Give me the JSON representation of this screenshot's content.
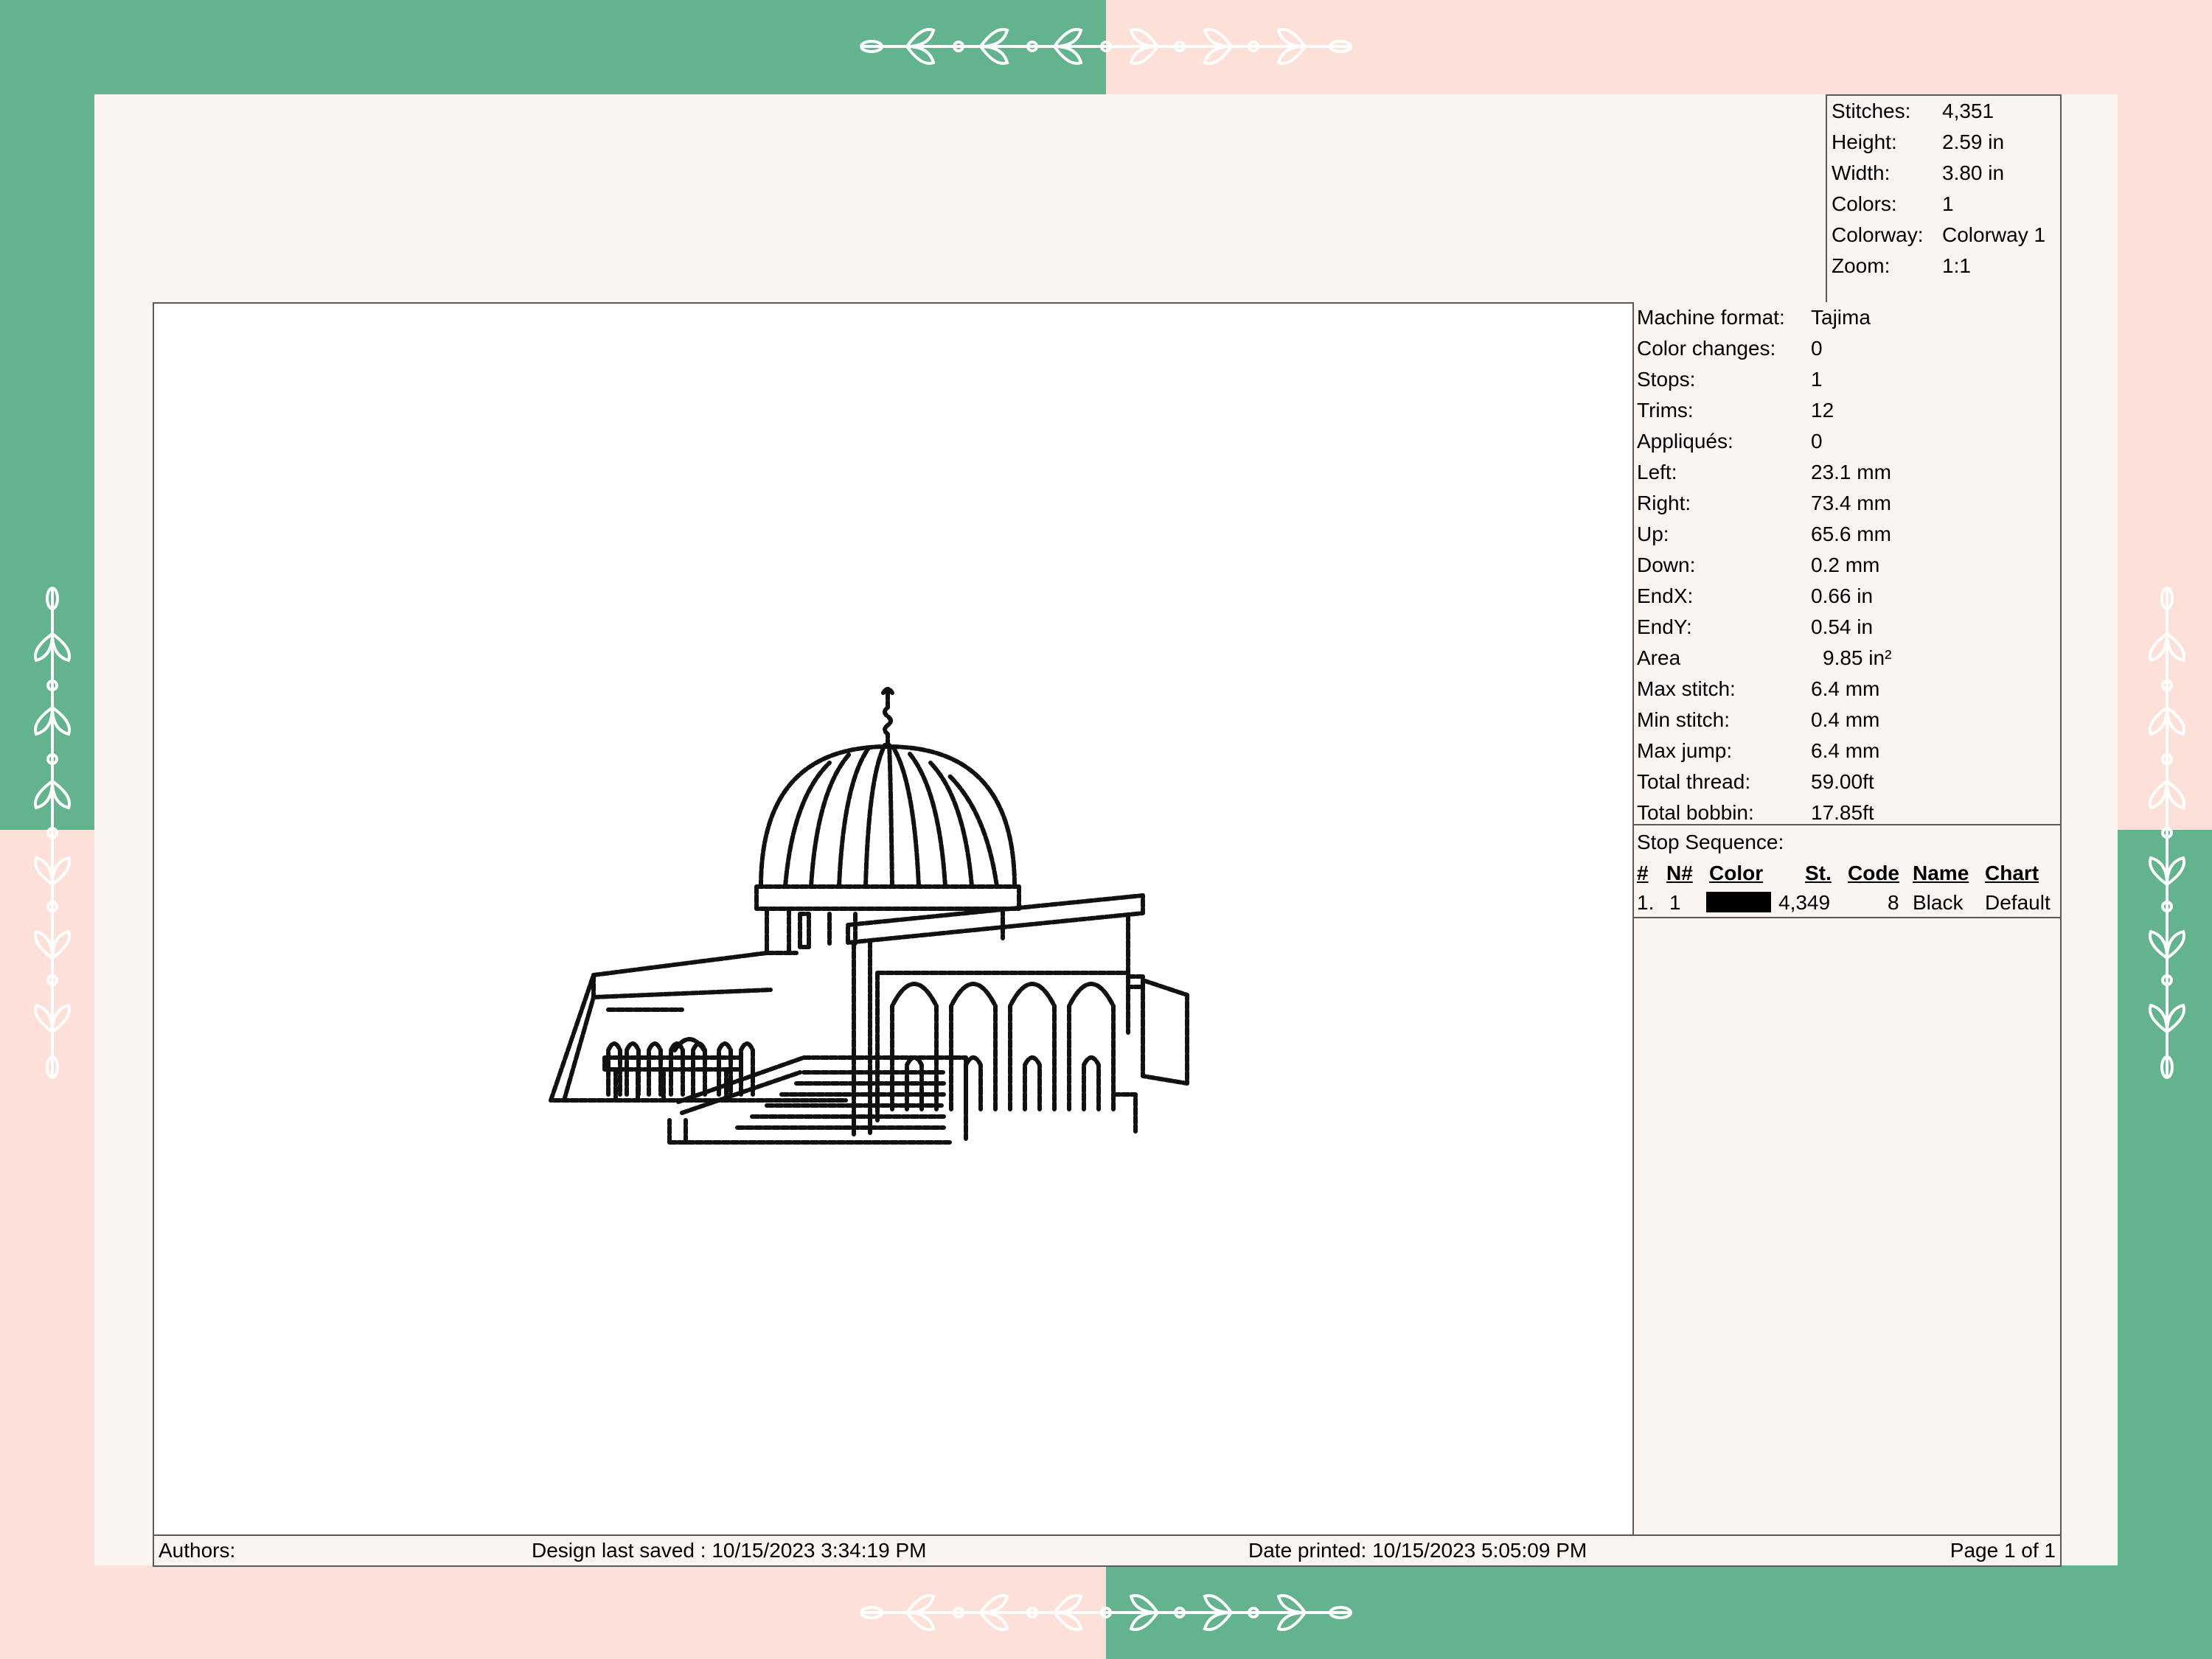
{
  "palette": {
    "green": "#63b38f",
    "pink": "#fde0d7",
    "sheet": "#fbf5f2",
    "swatch_black": "#000000"
  },
  "icons": [
    "vine-ornament-top-icon",
    "vine-ornament-bottom-icon",
    "vine-ornament-left-icon",
    "vine-ornament-right-icon"
  ],
  "summary": [
    {
      "label": "Stitches:",
      "value": "4,351"
    },
    {
      "label": "Height:",
      "value": "2.59 in"
    },
    {
      "label": "Width:",
      "value": "3.80 in"
    },
    {
      "label": "Colors:",
      "value": "1"
    },
    {
      "label": "Colorway:",
      "value": "Colorway 1"
    },
    {
      "label": "Zoom:",
      "value": "1:1"
    }
  ],
  "details": [
    {
      "label": "Machine format:",
      "value": "Tajima"
    },
    {
      "label": "Color changes:",
      "value": "0"
    },
    {
      "label": "Stops:",
      "value": "1"
    },
    {
      "label": "Trims:",
      "value": "12"
    },
    {
      "label": "Appliqués:",
      "value": "0"
    },
    {
      "label": "Left:",
      "value": "23.1 mm"
    },
    {
      "label": "Right:",
      "value": "73.4 mm"
    },
    {
      "label": "Up:",
      "value": "65.6 mm"
    },
    {
      "label": "Down:",
      "value": "0.2 mm"
    },
    {
      "label": "EndX:",
      "value": "0.66 in"
    },
    {
      "label": "EndY:",
      "value": "0.54 in"
    },
    {
      "label": "Area",
      "value": "9.85 in²"
    },
    {
      "label": "Max stitch:",
      "value": "6.4 mm"
    },
    {
      "label": "Min stitch:",
      "value": "0.4 mm"
    },
    {
      "label": "Max jump:",
      "value": "6.4 mm"
    },
    {
      "label": "Total thread:",
      "value": "59.00ft"
    },
    {
      "label": "Total bobbin:",
      "value": "17.85ft"
    }
  ],
  "stop_sequence": {
    "title": "Stop Sequence:",
    "headers": {
      "num": "#",
      "n_num": "N#",
      "color": "Color",
      "st": "St.",
      "code": "Code",
      "name": "Name",
      "chart": "Chart"
    },
    "rows": [
      {
        "num": "1.",
        "n_num": "1",
        "color": "#000000",
        "st": "4,349",
        "code": "8",
        "name": "Black",
        "chart": "Default"
      }
    ]
  },
  "footer": {
    "authors": "Authors:",
    "saved": "Design last saved : 10/15/2023 3:34:19 PM",
    "printed": "Date printed: 10/15/2023 5:05:09 PM",
    "page": "Page 1 of 1"
  }
}
